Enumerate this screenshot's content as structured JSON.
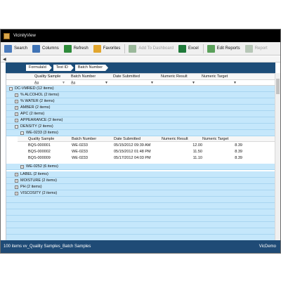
{
  "window": {
    "title": "VicinityView"
  },
  "toolbar": {
    "buttons": [
      {
        "label": "Search",
        "icon": "search-icon",
        "color": "#4a7bbd",
        "disabled": false
      },
      {
        "label": "Columns",
        "icon": "columns-icon",
        "color": "#3f73b5",
        "disabled": false
      },
      {
        "label": "Refresh",
        "icon": "refresh-icon",
        "color": "#2e8b3a",
        "disabled": false
      },
      {
        "label": "Favorites",
        "icon": "favorites-icon",
        "color": "#e2a62e",
        "disabled": false
      },
      {
        "label": "Add To Dashboard",
        "icon": "dashboard-icon",
        "color": "#9ab89a",
        "disabled": true
      },
      {
        "label": "Excel",
        "icon": "excel-icon",
        "color": "#1f7a3a",
        "disabled": false
      },
      {
        "label": "Edit Reports",
        "icon": "edit-reports-icon",
        "color": "#5aa05a",
        "disabled": false
      },
      {
        "label": "Report",
        "icon": "report-icon",
        "color": "#b7c7b7",
        "disabled": true
      }
    ]
  },
  "group_panel": {
    "tags": [
      "FormulaId",
      "Test ID",
      "Batch Number"
    ]
  },
  "columns": [
    "Quality Sample",
    "Batch Number",
    "Date Submitted",
    "Numeric Result",
    "Numeric Target"
  ],
  "filter_row": {
    "quality_sample": "A̲a̲",
    "batch_number": "A̲a̲"
  },
  "root_group": "DC-VMRED (12 items)",
  "groups_before": [
    "% ALCOHOL (2 items)",
    "% WATER (2 items)",
    "AMBER (2 items)",
    "APC (2 items)",
    "APPEARANCE (2 items)"
  ],
  "expanded_group": "DENSITY (2 items)",
  "sub_group_expanded": "WE-0233 (3 items)",
  "detail_rows": [
    {
      "quality_sample": "BQS-000001",
      "batch_number": "WE-0233",
      "date_submitted": "05/15/2012 09:39 AM",
      "numeric_result": "12.00",
      "numeric_target": "8.39"
    },
    {
      "quality_sample": "BQS-000002",
      "batch_number": "WE-0233",
      "date_submitted": "05/15/2012 01:48 PM",
      "numeric_result": "11.50",
      "numeric_target": "8.39"
    },
    {
      "quality_sample": "BQS-000009",
      "batch_number": "WE-0233",
      "date_submitted": "05/17/2012 04:03 PM",
      "numeric_result": "11.10",
      "numeric_target": "8.39"
    }
  ],
  "sub_group_collapsed": "WE-0252 (6 items)",
  "groups_after": [
    "LABEL (2 items)",
    "MOISTURE (2 items)",
    "PH (2 items)",
    "VISCOSITY (2 items)"
  ],
  "status": {
    "left": "100 items   vv_Quality Samples_Batch Samples",
    "right": "VicDemo"
  },
  "colors": {
    "title_bar": "#000000",
    "header_band": "#1d4d78",
    "group_row": "#c5e7fb",
    "status_bar": "#1f4b76"
  }
}
